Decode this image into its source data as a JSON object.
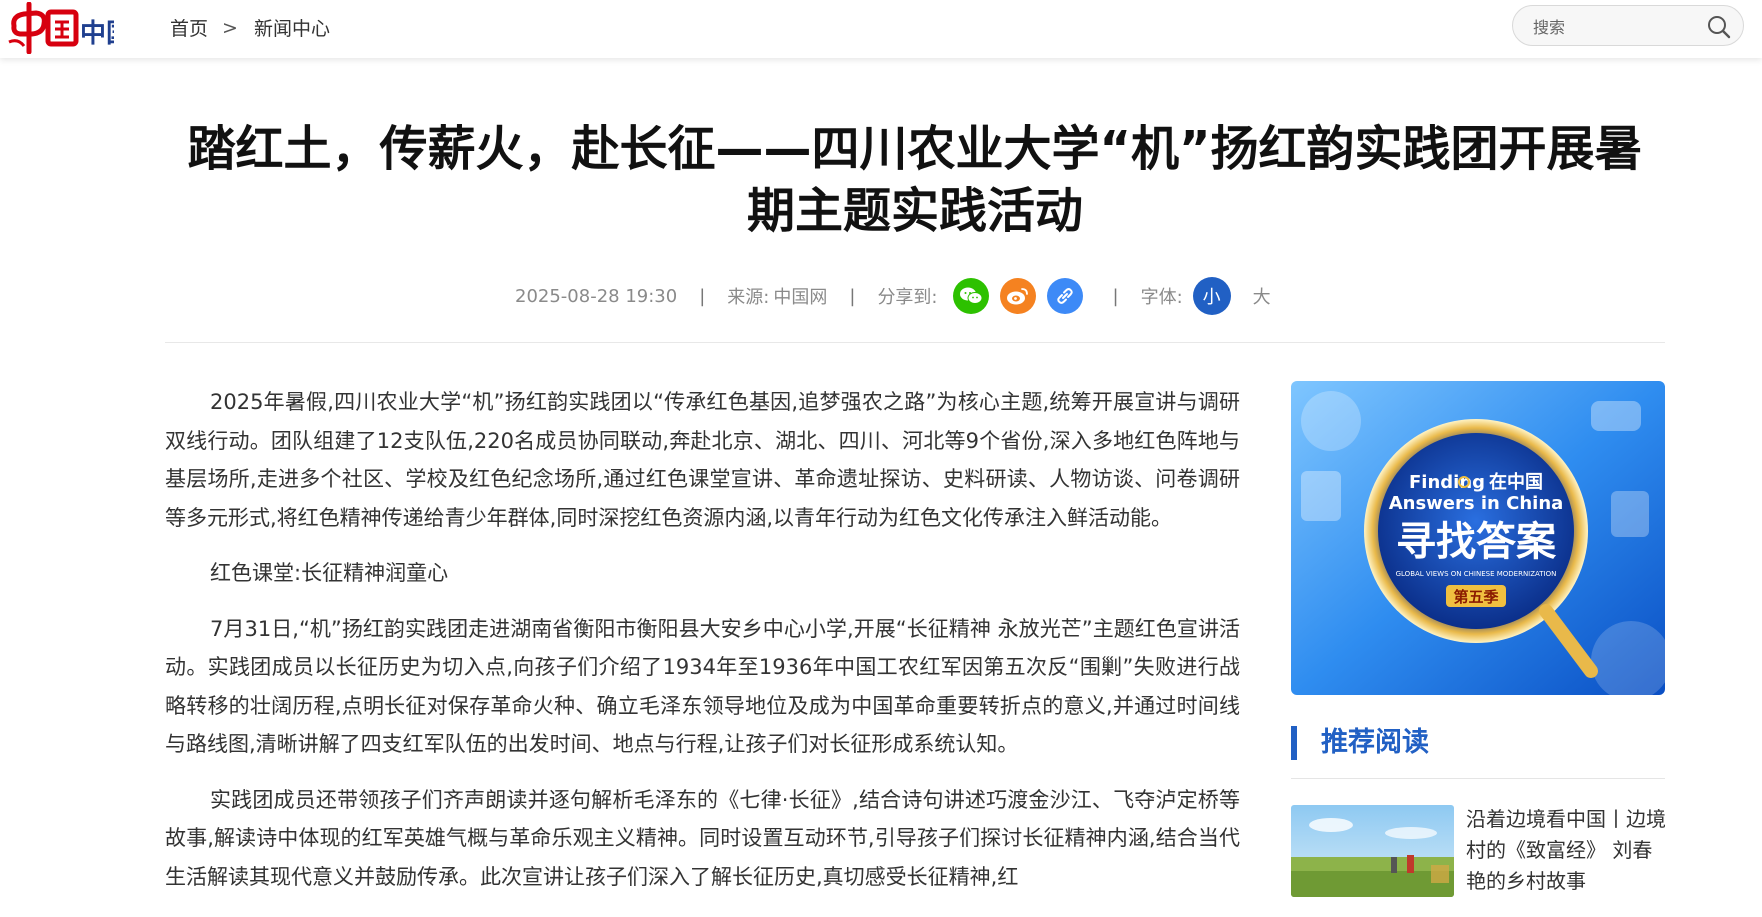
{
  "header": {
    "logo_text": "中国网",
    "breadcrumb": {
      "home": "首页",
      "separator": ">",
      "section": "新闻中心"
    },
    "search": {
      "placeholder": "搜索",
      "icon": "search-icon"
    }
  },
  "article": {
    "title": "踏红土，传薪火，赴长征——四川农业大学“机”扬红韵实践团开展暑期主题实践活动",
    "meta": {
      "datetime": "2025-08-28 19:30",
      "separator": "|",
      "source_label": "来源:",
      "source": "中国网",
      "share_label": "分享到:",
      "share_icons": [
        "wechat-icon",
        "weibo-icon",
        "link-icon"
      ],
      "font_label": "字体:",
      "font_small": "小",
      "font_large": "大"
    },
    "paragraphs": [
      "2025年暑假,四川农业大学“机”扬红韵实践团以“传承红色基因,追梦强农之路”为核心主题,统筹开展宣讲与调研双线行动。团队组建了12支队伍,220名成员协同联动,奔赴北京、湖北、四川、河北等9个省份,深入多地红色阵地与基层场所,走进多个社区、学校及红色纪念场所,通过红色课堂宣讲、革命遗址探访、史料研读、人物访谈、问卷调研等多元形式,将红色精神传递给青少年群体,同时深挖红色资源内涵,以青年行动为红色文化传承注入鲜活动能。",
      "红色课堂:长征精神润童心",
      "7月31日,“机”扬红韵实践团走进湖南省衡阳市衡阳县大安乡中心小学,开展“长征精神 永放光芒”主题红色宣讲活动。实践团成员以长征历史为切入点,向孩子们介绍了1934年至1936年中国工农红军因第五次反“围剿”失败进行战略转移的壮阔历程,点明长征对保存革命火种、确立毛泽东领导地位及成为中国革命重要转折点的意义,并通过时间线与路线图,清晰讲解了四支红军队伍的出发时间、地点与行程,让孩子们对长征形成系统认知。",
      "实践团成员还带领孩子们齐声朗读并逐句解析毛泽东的《七律·长征》,结合诗句讲述巧渡金沙江、飞夺泸定桥等故事,解读诗中体现的红军英雄气概与革命乐观主义精神。同时设置互动环节,引导孩子们探讨长征精神内涵,结合当代生活解读其现代意义并鼓励传承。此次宣讲让孩子们深入了解长征历史,真切感受长征精神,红"
    ]
  },
  "sidebar": {
    "banner": {
      "line1_en": "Finding",
      "line1_cn": "在中国",
      "line2_en": "Answers in China",
      "main_cn": "寻找答案",
      "sub_en": "GLOBAL VIEWS ON CHINESE MODERNIZATION",
      "season": "第五季"
    },
    "recommend": {
      "title": "推荐阅读",
      "items": [
        {
          "text": "沿着边境看中国丨边境村的《致富经》 刘春艳的乡村故事"
        }
      ]
    }
  },
  "colors": {
    "accent_blue": "#2160c4",
    "logo_red": "#d7000f",
    "wechat_green": "#2dc100",
    "weibo_orange": "#f58220",
    "link_blue": "#3d8af7"
  }
}
